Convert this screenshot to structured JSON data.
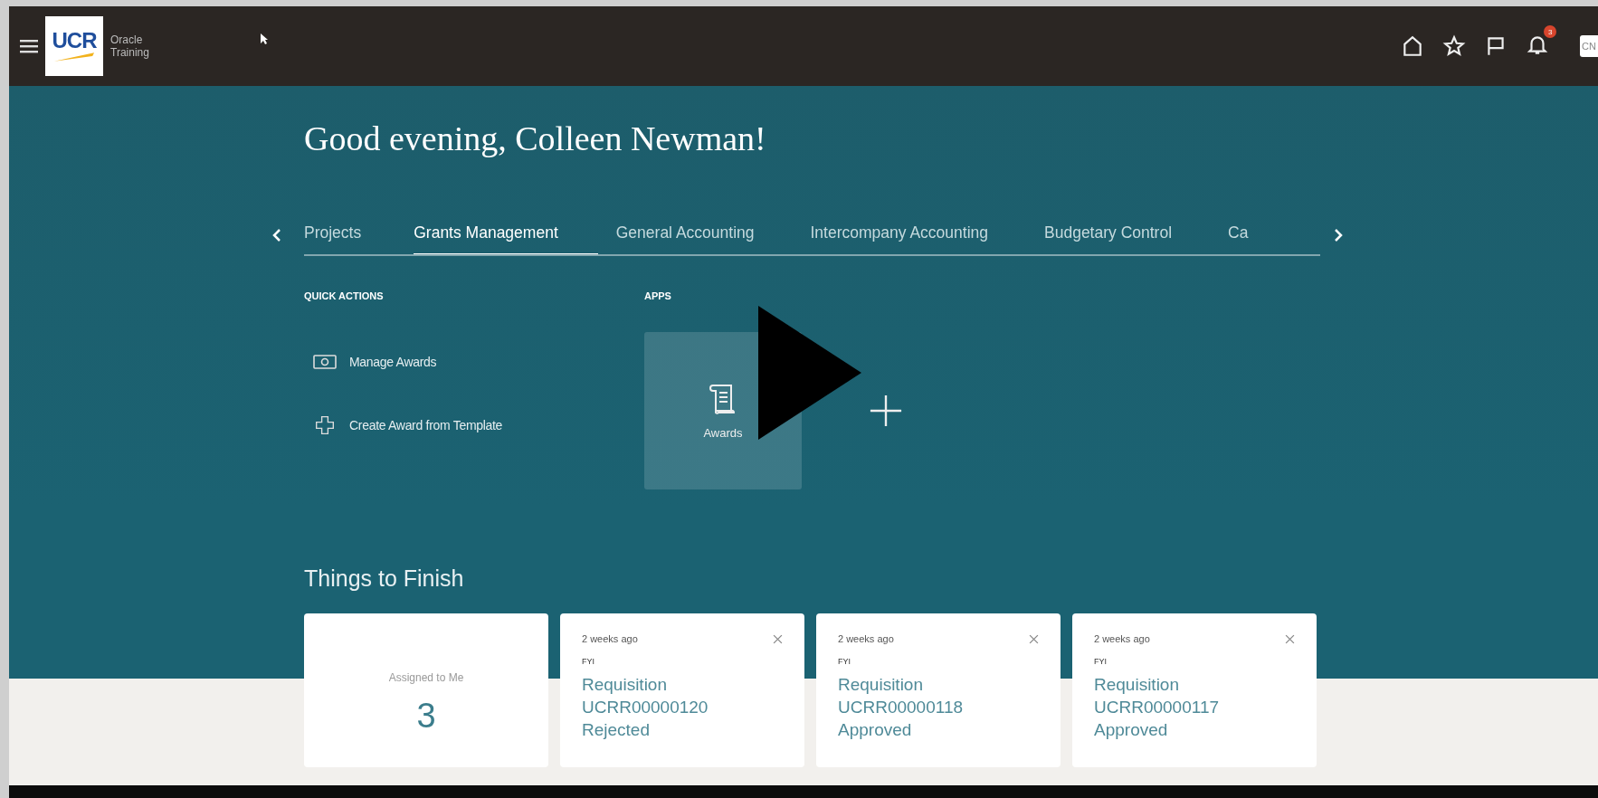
{
  "header": {
    "logo": "UCR",
    "app_name": [
      "Oracle",
      "Training"
    ],
    "notification_count": "3",
    "avatar_initials": "CN"
  },
  "greeting": "Good evening, Colleen Newman!",
  "tabs": [
    {
      "label": "Projects",
      "selected": false
    },
    {
      "label": "Grants Management",
      "selected": true
    },
    {
      "label": "General Accounting",
      "selected": false
    },
    {
      "label": "Intercompany Accounting",
      "selected": false
    },
    {
      "label": "Budgetary Control",
      "selected": false
    },
    {
      "label": "Ca",
      "selected": false
    }
  ],
  "quick_actions": {
    "title": "QUICK ACTIONS",
    "items": [
      {
        "label": "Manage Awards",
        "kind": "manage"
      },
      {
        "label": "Create Award from Template",
        "kind": "create"
      }
    ]
  },
  "apps": {
    "title": "APPS",
    "items": [
      {
        "label": "Awards"
      }
    ]
  },
  "things_to_finish": {
    "title": "Things to Finish",
    "cards": [
      {
        "kind": "summary",
        "label": "Assigned to Me",
        "count": "3"
      },
      {
        "kind": "notification",
        "time": "2 weeks ago",
        "type": "FYI",
        "title": [
          "Requisition",
          "UCRR00000120",
          "Rejected"
        ]
      },
      {
        "kind": "notification",
        "time": "2 weeks ago",
        "type": "FYI",
        "title": [
          "Requisition",
          "UCRR00000118",
          "Approved"
        ]
      },
      {
        "kind": "notification",
        "time": "2 weeks ago",
        "type": "FYI",
        "title": [
          "Requisition",
          "UCRR00000117",
          "Approved"
        ]
      }
    ]
  }
}
